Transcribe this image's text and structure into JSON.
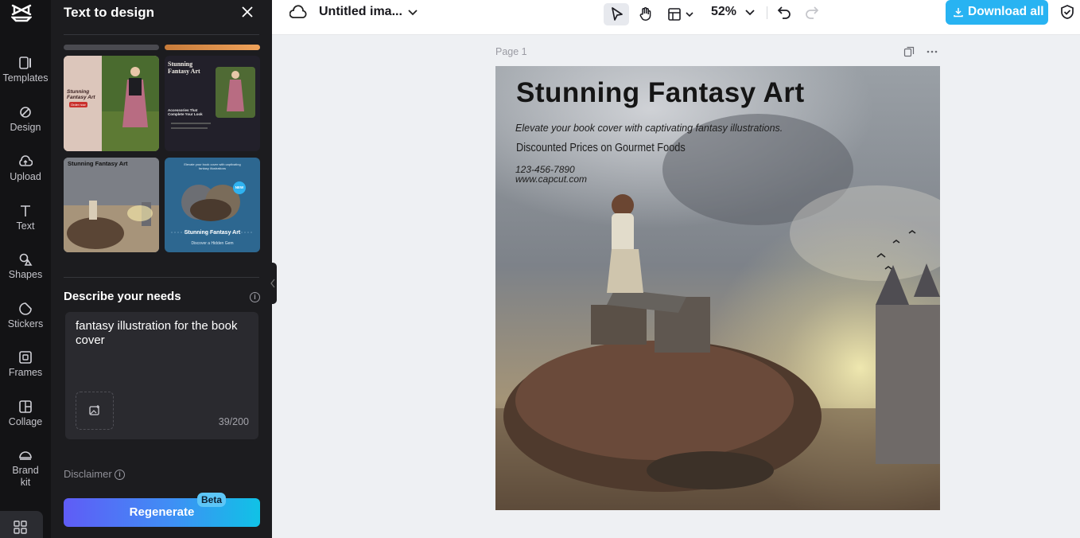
{
  "rail": {
    "items": [
      {
        "label": "Templates",
        "icon": "templates-icon"
      },
      {
        "label": "Design",
        "icon": "design-icon"
      },
      {
        "label": "Upload",
        "icon": "upload-cloud-icon"
      },
      {
        "label": "Text",
        "icon": "text-icon"
      },
      {
        "label": "Shapes",
        "icon": "shapes-icon"
      },
      {
        "label": "Stickers",
        "icon": "stickers-icon"
      },
      {
        "label": "Frames",
        "icon": "frames-icon"
      },
      {
        "label": "Collage",
        "icon": "collage-icon"
      },
      {
        "label": "Brand kit",
        "icon": "brand-kit-icon"
      }
    ]
  },
  "panel": {
    "title": "Text to design",
    "templates": [
      {
        "title": "Stunning Fantasy Art",
        "button": "Order now"
      },
      {
        "title": "Stunning Fantasy Art",
        "heading": "Accessories That Complete Your Look"
      },
      {
        "title": "Stunning Fantasy Art"
      },
      {
        "title": "Stunning Fantasy Art",
        "subtitle": "Discover a Hidden Gem",
        "badge": "NEW",
        "top_text": "Elevate your book cover with captivating fantasy illustrations"
      }
    ],
    "describe_title": "Describe your needs",
    "prompt_value": "fantasy illustration for the book cover",
    "char_count": "39/200",
    "disclaimer": "Disclaimer",
    "regenerate_label": "Regenerate",
    "beta_badge": "Beta"
  },
  "topbar": {
    "doc_title": "Untitled ima...",
    "zoom": "52%",
    "download_label": "Download all"
  },
  "canvas": {
    "page_label": "Page 1",
    "title": "Stunning Fantasy Art",
    "subtitle": "Elevate your book cover with captivating fantasy illustrations.",
    "price_line": "Discounted Prices on Gourmet Foods",
    "phone": "123-456-7890",
    "website": "www.capcut.com"
  },
  "colors": {
    "accent": "#28b3f2",
    "panel_bg": "#1c1c1f",
    "rail_bg": "#131315",
    "canvas_bg": "#eef0f3"
  }
}
